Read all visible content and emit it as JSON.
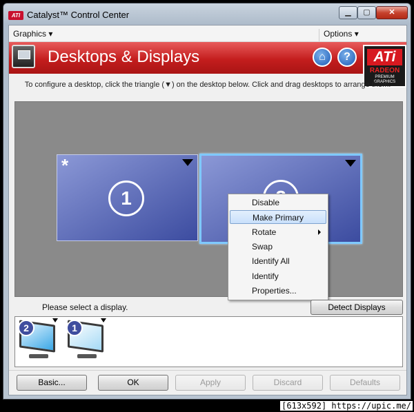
{
  "window": {
    "title": "Catalyst™ Control Center",
    "logo_text": "ATI",
    "controls": {
      "minimize": "▁",
      "maximize": "▢",
      "close": "✕"
    }
  },
  "menu": {
    "graphics": "Graphics ▾",
    "options": "Options ▾"
  },
  "header": {
    "title": "Desktops & Displays",
    "home_glyph": "⌂",
    "help_glyph": "?",
    "badge": {
      "ati": "ATi",
      "radeon": "RADEON",
      "sub1": "PREMIUM",
      "sub2": "GRAPHICS"
    }
  },
  "instruction": "To configure a desktop, click the triangle (▼) on the desktop below.  Click and drag desktops to arrange them.",
  "desktops": [
    {
      "number": "1",
      "primary_marker": "*"
    },
    {
      "number": "2"
    }
  ],
  "context_menu": {
    "items": [
      "Disable",
      "Make Primary",
      "Rotate",
      "Swap",
      "Identify All",
      "Identify",
      "Properties..."
    ],
    "highlighted": "Make Primary"
  },
  "select_label": "Please select a display.",
  "detect_button": "Detect Displays",
  "display_thumbs": [
    {
      "number": "2"
    },
    {
      "number": "1"
    }
  ],
  "buttons": {
    "basic": "Basic...",
    "ok": "OK",
    "apply": "Apply",
    "discard": "Discard",
    "defaults": "Defaults"
  },
  "watermark": "[613x592] https://upic.me/"
}
